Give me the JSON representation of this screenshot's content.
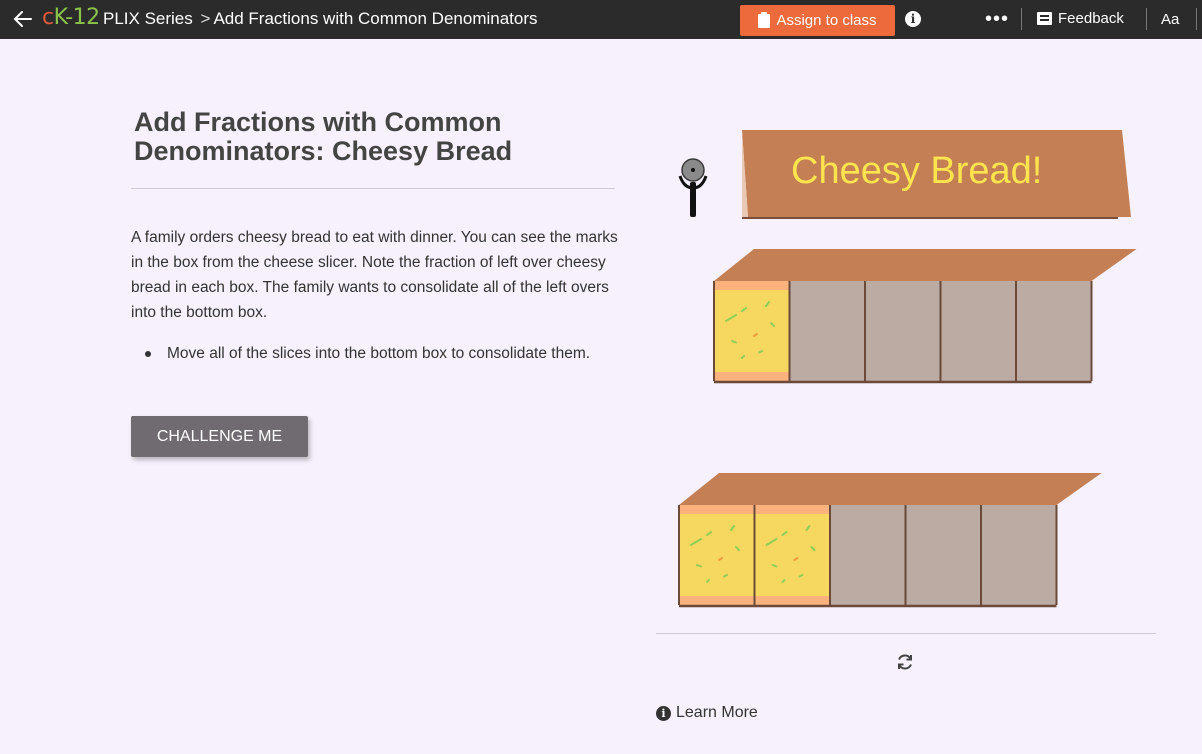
{
  "header": {
    "logo_c": "c",
    "logo_k": "K",
    "logo_rest": "-12",
    "series": "PLIX Series",
    "separator": ">",
    "page": "Add Fractions with Common Denominators",
    "assign_label": "Assign to class",
    "more_label": "•••",
    "feedback_label": "Feedback",
    "font_label": "Aa"
  },
  "main": {
    "title": "Add Fractions with Common Denominators: Cheesy Bread",
    "description": "A family orders cheesy bread to eat with dinner. You can see the marks in the box from the cheese slicer. Note the fraction of left over cheesy bread in each box. The family wants to consolidate all of the left overs into the bottom box.",
    "bullet": "Move all of the slices into the bottom box to consolidate them.",
    "challenge_label": "CHALLENGE ME"
  },
  "interactive": {
    "sign_text": "Cheesy Bread!",
    "top_box": {
      "total_slices": 5,
      "cheesy_slices": 1
    },
    "bottom_box": {
      "total_slices": 5,
      "cheesy_slices": 2
    },
    "learn_more_label": "Learn More",
    "info_glyph": "i"
  },
  "colors": {
    "topbar": "#2b2b2b",
    "accent": "#ec6a3c",
    "box_lid": "#c47f54",
    "box_empty": "#bbaba2",
    "cheese": "#f6d860",
    "crust": "#fbb27d",
    "sign_text": "#fbe44e"
  }
}
